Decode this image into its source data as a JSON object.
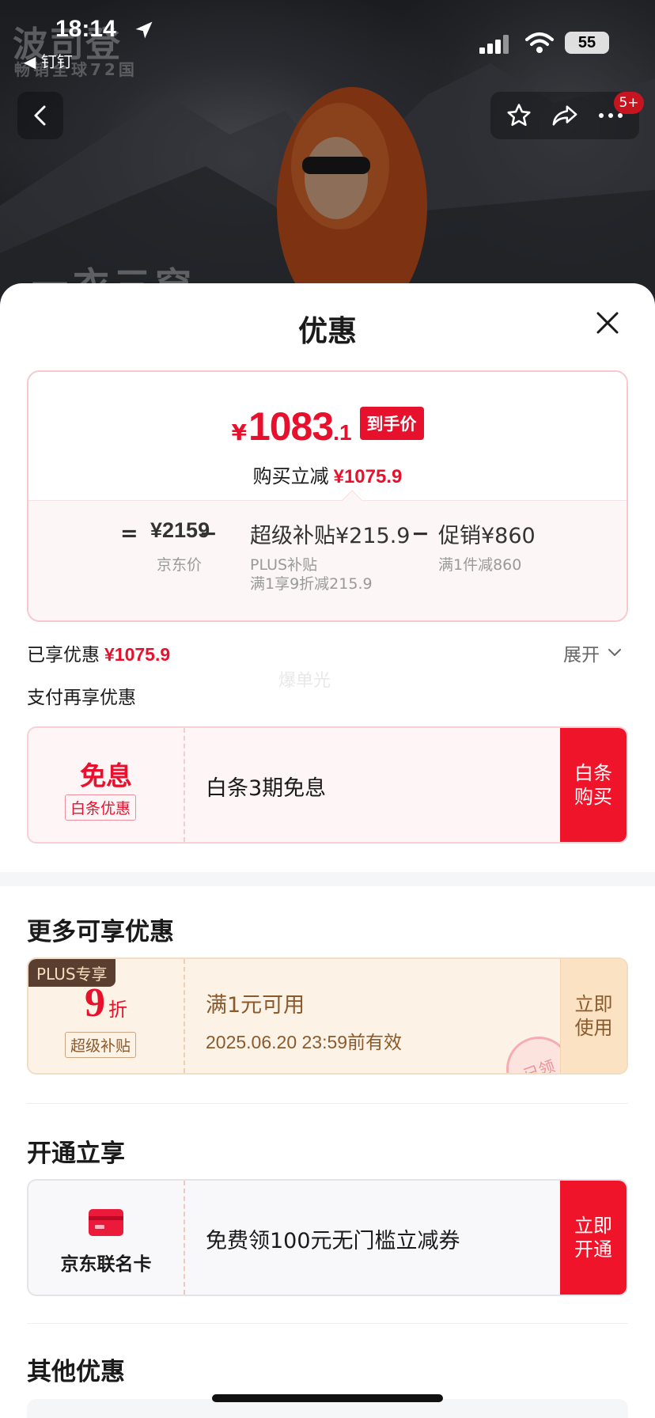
{
  "status_bar": {
    "time": "18:14",
    "back_app": "◀ 钉钉",
    "battery": "55"
  },
  "hero": {
    "brand": "波司登",
    "brand_sub": "畅销全球72国",
    "slogan": "一衣三穿"
  },
  "nav": {
    "badge": "5+"
  },
  "sheet": {
    "title": "优惠"
  },
  "price_summary": {
    "currency": "¥",
    "price_int": "1083",
    "price_dec": ".1",
    "price_tag": "到手价",
    "reduce_label": "购买立减",
    "reduce_value": "¥1075.9",
    "equals": "=",
    "jd_price": "¥2159",
    "jd_price_label": "京东价",
    "minus1": "−",
    "subsidy": "超级补贴¥215.9",
    "subsidy_label1": "PLUS补贴",
    "subsidy_label2": "满1享9折减215.9",
    "minus2": "−",
    "promo": "促销¥860",
    "promo_label": "满1件减860"
  },
  "enjoyed": {
    "label": "已享优惠",
    "value": "¥1075.9",
    "expand": "展开",
    "watermark": "爆单光",
    "pay_title": "支付再享优惠"
  },
  "coupon_baitiao": {
    "title": "免息",
    "tag": "白条优惠",
    "text": "白条3期免息",
    "action": "白条购买"
  },
  "section_more": {
    "title": "更多可享优惠"
  },
  "coupon_plus": {
    "plus_tag": "PLUS专享",
    "discount": "9",
    "discount_unit": "折",
    "tag": "超级补贴",
    "line1": "满1元可用",
    "line2": "2025.06.20 23:59前有效",
    "stamp": "已领",
    "action": "立即使用"
  },
  "section_open": {
    "title": "开通立享"
  },
  "coupon_card": {
    "name": "京东联名卡",
    "text": "免费领100元无门槛立减券",
    "action": "立即开通"
  },
  "section_other": {
    "title": "其他优惠"
  },
  "colors": {
    "accent_red": "#e8112d",
    "gold_brown": "#8a5a2c"
  }
}
